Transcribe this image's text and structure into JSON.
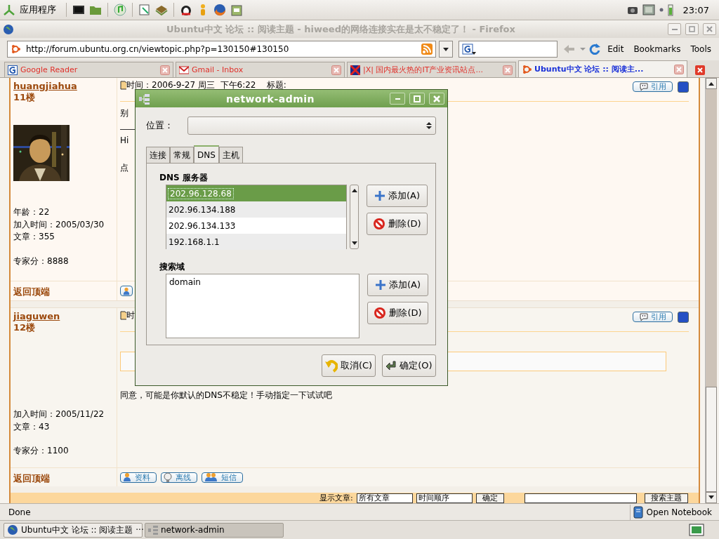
{
  "panel": {
    "menu": "应用程序",
    "clock": "23:07"
  },
  "browser": {
    "title": "Ubuntu中文 论坛 :: 阅读主题 - hiweed的网络连接实在是太不稳定了！ - Firefox",
    "url": "http://forum.ubuntu.org.cn/viewtopic.php?p=130150#130150",
    "menu": [
      "Edit",
      "Bookmarks",
      "Tools"
    ],
    "tabs": [
      {
        "label": "Google Reader",
        "kind": "google",
        "selected": false
      },
      {
        "label": "Gmail - Inbox",
        "kind": "gmail",
        "selected": false
      },
      {
        "label": "|X| 国内最火热的IT产业资讯站点...",
        "kind": "flag",
        "selected": false
      },
      {
        "label": "Ubuntu中文 论坛 :: 阅读主...",
        "kind": "ubuntu",
        "selected": true
      }
    ],
    "status": "Done",
    "status_button": "Open Notebook"
  },
  "posts": [
    {
      "author": "huangjiahua",
      "floor": "11楼",
      "avatar": {
        "kind": "picture"
      },
      "stats": [
        {
          "text": "年龄：22",
          "gap_before": false
        },
        {
          "text": "加入时间：2005/03/30",
          "gap_before": false
        },
        {
          "text": "文章：355",
          "gap_before": false
        },
        {
          "text": "专家分：8888",
          "gap_before": true
        }
      ],
      "time": "时间：2006-9-27 周三  下午6:22    标题:",
      "lines": [
        {
          "kind": "text",
          "text": "别"
        },
        {
          "kind": "rule"
        },
        {
          "kind": "text",
          "text": "Hi"
        },
        {
          "kind": "text",
          "text": "点"
        }
      ],
      "quote": "引用",
      "back_to_top": "返回顶端",
      "actions": [
        {
          "kind": "profile"
        }
      ]
    },
    {
      "author": "jiaguwen",
      "floor": "12楼",
      "stats": [
        {
          "text": "加入时间：2005/11/22",
          "gap_before": false
        },
        {
          "text": "文章：43",
          "gap_before": false
        },
        {
          "text": "专家分：1100",
          "gap_before": true
        }
      ],
      "time": "时",
      "lines": [
        {
          "kind": "quotebox"
        },
        {
          "kind": "text",
          "text": "同意，可能是你默认的DNS不稳定！手动指定一下试试吧"
        }
      ],
      "quote": "引用",
      "back_to_top": "返回顶端",
      "actions": [
        {
          "kind": "profile",
          "label": "资料"
        },
        {
          "kind": "offline",
          "label": "离线"
        },
        {
          "kind": "message",
          "label": "短信"
        }
      ]
    }
  ],
  "footer": {
    "label": "显示文章:",
    "selects": [
      "所有文章",
      "时间顺序"
    ],
    "submit": "确定",
    "search_button": "搜索主题"
  },
  "dialog": {
    "title": "network-admin",
    "location_label": "位置：",
    "tabs": [
      {
        "label": "连接",
        "selected": false
      },
      {
        "label": "常规",
        "selected": false
      },
      {
        "label": "DNS",
        "selected": true
      },
      {
        "label": "主机",
        "selected": false
      }
    ],
    "dns": {
      "heading": "DNS 服务器",
      "servers": [
        {
          "address": "202.96.128.68",
          "selected": true
        },
        {
          "address": "202.96.134.188",
          "selected": false
        },
        {
          "address": "202.96.134.133",
          "selected": false
        },
        {
          "address": "192.168.1.1",
          "selected": false
        }
      ],
      "buttons": [
        {
          "label": "添加(A)",
          "kind": "add"
        },
        {
          "label": "删除(D)",
          "kind": "remove"
        }
      ]
    },
    "search": {
      "heading": "搜索域",
      "domains": [
        {
          "name": "domain",
          "selected": false
        }
      ],
      "buttons": [
        {
          "label": "添加(A)",
          "kind": "add"
        },
        {
          "label": "删除(D)",
          "kind": "remove"
        }
      ]
    },
    "buttons": [
      {
        "label": "取消(C)",
        "kind": "cancel"
      },
      {
        "label": "确定(O)",
        "kind": "ok"
      }
    ]
  },
  "taskbar": [
    {
      "label": "Ubuntu中文 论坛 :: 阅读主题 ···",
      "kind": "browser",
      "selected": false
    },
    {
      "label": "network-admin",
      "kind": "network",
      "selected": true
    }
  ]
}
